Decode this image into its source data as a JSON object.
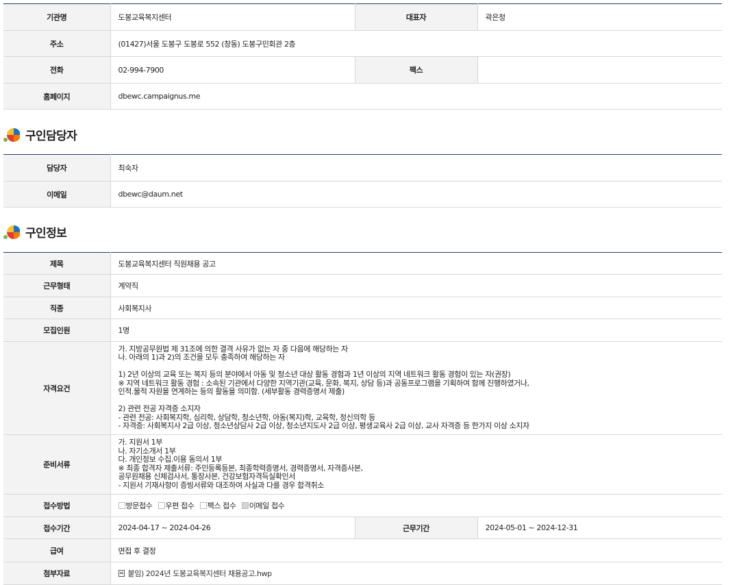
{
  "org": {
    "rows": [
      {
        "label1": "기관명",
        "value1": "도봉교육복지센터",
        "label2": "대표자",
        "value2": "곽은정"
      },
      {
        "label": "주소",
        "value": "(01427)서울 도봉구 도봉로 552 (창동) 도봉구민회관 2층"
      },
      {
        "label1": "전화",
        "value1": "02-994-7900",
        "label2": "팩스",
        "value2": ""
      },
      {
        "label": "홈페이지",
        "value": "dbewc.campaignus.me"
      }
    ]
  },
  "contact": {
    "title": "구인담당자",
    "rows": [
      {
        "label": "담당자",
        "value": "최숙자"
      },
      {
        "label": "이메일",
        "value": "dbewc@daum.net"
      }
    ]
  },
  "job": {
    "title": "구인정보",
    "subject": {
      "label": "제목",
      "value": "도봉교육복지센터 직원채용 공고"
    },
    "employment_type": {
      "label": "근무형태",
      "value": "계약직"
    },
    "occupation": {
      "label": "직종",
      "value": "사회복지사"
    },
    "headcount": {
      "label": "모집인원",
      "value": "1명"
    },
    "qualification": {
      "label": "자격요건",
      "value": "가. 지방공무원법 제 31조에 의한 결격 사유가 없는 자 중 다음에 해당하는 자\n나. 아래의 1)과 2)의 조건을 모두 충족하여 해당하는 자\n\n1) 2년 이상의 교육 또는 복지 등의 분야에서 아동 및 청소년 대상 활동 경험과 1년 이상의 지역 네트워크 활동 경험이 있는 자(권장)\n※ 지역 네트워크 활동 경험 : 소속된 기관에서 다양한 지역기관(교육, 문화, 복지, 상담 등)과 공동프로그램을 기획하여 함께 진행하였거나,\n    인적.물적 자원을 연계하는 등의 활동을 의미함. (세부활동 경력증명서 제출)\n\n2) 관련 전공 자격증 소지자\n- 관련 전공: 사회복지학, 심리학, 상담학, 청소년학, 아동(복지)학, 교육학, 정신의학 등\n- 자격증: 사회복지사 2급 이상, 청소년상담사 2급 이상, 청소년지도사 2급 이상, 평생교육사 2급 이상, 교사 자격증 등 한가지 이상 소지자"
    },
    "documents": {
      "label": "준비서류",
      "value": "가. 지원서 1부\n나. 자기소개서 1부\n다. 개인정보 수집.이용 동의서 1부\n  ※ 최종 합격자 제출서류: 주민등록등본, 최종학력증명서, 경력증명서, 자격증사본,\n    공무원채용 신체검사서, 통장사본, 건강보험자격득실확인서\n    - 지원서 기재사항이 증빙서류와 대조하여 사실과 다를 경우 합격취소"
    },
    "method": {
      "label": "접수방법",
      "options": [
        {
          "label": "방문접수",
          "checked": false
        },
        {
          "label": "우편 접수",
          "checked": false
        },
        {
          "label": "팩스 접수",
          "checked": false
        },
        {
          "label": "이메일 접수",
          "checked": true
        }
      ]
    },
    "period": {
      "label1": "접수기간",
      "value1": "2024-04-17 ~ 2024-04-26",
      "label2": "근무기간",
      "value2": "2024-05-01 ~ 2024-12-31"
    },
    "salary": {
      "label": "급여",
      "value": "면접 후 결정"
    },
    "attachment": {
      "label": "첨부자료",
      "value": "붙임)  2024년  도봉교육복지센터  채용공고.hwp"
    }
  },
  "colors": {
    "border_top": "#1f3d6b",
    "header_bg": "#f3f3f3",
    "row_border": "#d7d7d7"
  }
}
